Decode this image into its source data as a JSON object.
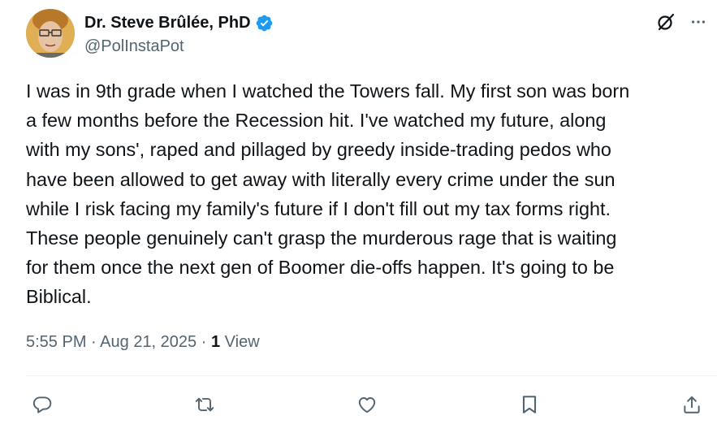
{
  "author": {
    "display_name": "Dr. Steve Brûlée, PhD",
    "handle": "@PolInstaPot",
    "verified": true
  },
  "post": {
    "text": "I was in 9th grade when I watched the Towers fall. My first son was born\na few months before the Recession hit. I've watched my future, along\nwith my sons', raped and pillaged by greedy inside-trading pedos who\nhave been allowed to get away with literally every crime under the sun\nwhile I risk facing my family's future if I don't fill out my tax forms right.\nThese people genuinely can't grasp the murderous rage that is waiting\nfor them once the next gen of Boomer die-offs happen. It's going to be\nBiblical.",
    "time": "5:55 PM",
    "date": "Aug 21, 2025",
    "separator": "·",
    "views_count": "1",
    "views_label": "View"
  },
  "icons": {
    "grok": "grok-icon",
    "more": "more-icon",
    "reply": "reply-icon",
    "repost": "repost-icon",
    "like": "like-icon",
    "bookmark": "bookmark-icon",
    "share": "share-icon"
  },
  "colors": {
    "text": "#0f1419",
    "secondary": "#536471",
    "verified": "#1d9bf0",
    "divider": "#eff3f4"
  }
}
